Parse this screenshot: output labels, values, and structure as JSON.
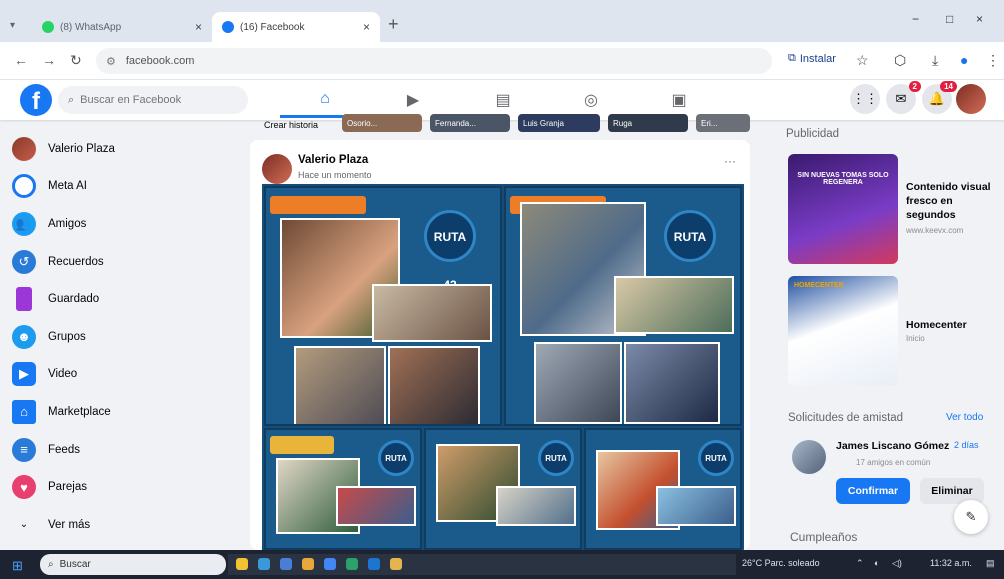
{
  "browser": {
    "tabs": [
      {
        "label": "(8) WhatsApp",
        "close": "×"
      },
      {
        "label": "(16) Facebook",
        "close": "×"
      }
    ],
    "new_tab": "+",
    "window_controls": [
      "−",
      "□",
      "×"
    ],
    "url": "facebook.com",
    "install_label": "Instalar"
  },
  "fb": {
    "search_placeholder": "Buscar en Facebook",
    "badges": {
      "messenger": "2",
      "notifications": "14"
    },
    "stories": {
      "create_label": "Crear historia",
      "names": [
        "Osorio...",
        "Fernanda...",
        "Luis Granja",
        "Ruga",
        "Eri..."
      ]
    },
    "sidebar": [
      {
        "label": "Valerio Plaza",
        "icon": "avatar"
      },
      {
        "label": "Meta AI",
        "icon": "meta-ai-icon"
      },
      {
        "label": "Amigos",
        "icon": "friends-icon"
      },
      {
        "label": "Recuerdos",
        "icon": "memories-icon"
      },
      {
        "label": "Guardado",
        "icon": "saved-icon"
      },
      {
        "label": "Grupos",
        "icon": "groups-icon"
      },
      {
        "label": "Video",
        "icon": "video-icon"
      },
      {
        "label": "Marketplace",
        "icon": "marketplace-icon"
      },
      {
        "label": "Feeds",
        "icon": "feeds-icon"
      },
      {
        "label": "Parejas",
        "icon": "heart-icon"
      },
      {
        "label": "Ver más",
        "icon": "chevron-down-icon"
      }
    ],
    "post": {
      "author": "Valerio Plaza",
      "meta": "Hace un momento",
      "more": "···",
      "badge_text": "RUTA 42"
    },
    "right": {
      "ads_title": "Publicidad",
      "ads": [
        {
          "title": "Contenido visual fresco en segundos",
          "url": "www.keevx.com",
          "image_headline": "SIN NUEVAS TOMAS SOLO REGENERA"
        },
        {
          "title": "Homecenter",
          "url": "Inicio",
          "image_headline": "HOMECENTER"
        }
      ],
      "requests_title": "Solicitudes de amistad",
      "see_all": "Ver todo",
      "request": {
        "name": "James Liscano Gómez",
        "time": "2 días",
        "mutual": "17 amigos en común"
      },
      "confirm": "Confirmar",
      "delete": "Eliminar",
      "birthdays_title": "Cumpleaños"
    }
  },
  "taskbar": {
    "search": "Buscar",
    "weather": "26°C  Parc. soleado",
    "time": "11:32 a.m."
  }
}
